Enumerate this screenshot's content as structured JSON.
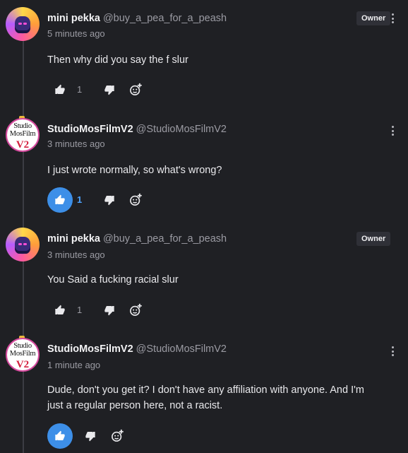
{
  "comments": [
    {
      "username": "mini pekka",
      "handle": "@buy_a_pea_for_a_peash",
      "time": "5 minutes ago",
      "badge": "Owner",
      "text": "Then why did you say the f slur",
      "likes": "1",
      "liked": false,
      "avatar": "mini-pekka-avatar"
    },
    {
      "username": "StudioMosFilmV2",
      "handle": "@StudioMosFilmV2",
      "time": "3 minutes ago",
      "badge": "",
      "text": "I just wrote normally, so what's wrong?",
      "likes": "1",
      "liked": true,
      "avatar": "studiomosfilm-avatar"
    },
    {
      "username": "mini pekka",
      "handle": "@buy_a_pea_for_a_peash",
      "time": "3 minutes ago",
      "badge": "Owner",
      "text": "You Said a fucking racial slur",
      "likes": "1",
      "liked": false,
      "avatar": "mini-pekka-avatar"
    },
    {
      "username": "StudioMosFilmV2",
      "handle": "@StudioMosFilmV2",
      "time": "1 minute ago",
      "badge": "",
      "text": "Dude, don't you get it? I don't have any affiliation with anyone. And I'm just a regular person here, not a racist.",
      "likes": "",
      "liked": true,
      "avatar": "studiomosfilm-avatar"
    }
  ],
  "avatar_text": {
    "line1": "Studio",
    "line2": "MosFilm",
    "line3": "V2"
  },
  "colors": {
    "background": "#1f2024",
    "accent": "#3d8fe8",
    "owner_badge": "#2f3037"
  },
  "icons": {
    "like": "thumbs-up-icon",
    "dislike": "thumbs-down-icon",
    "react": "add-emoji-icon",
    "menu": "more-vertical-icon"
  }
}
